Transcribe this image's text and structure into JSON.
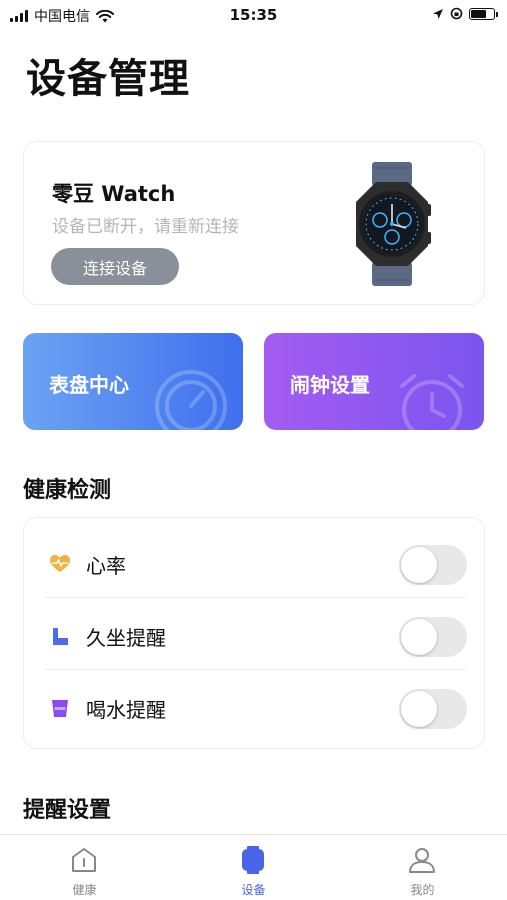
{
  "status_bar": {
    "carrier": "中国电信",
    "time": "15:35"
  },
  "page": {
    "title": "设备管理"
  },
  "device": {
    "name": "零豆 Watch",
    "status": "设备已断开，请重新连接",
    "connect_label": "连接设备"
  },
  "features": {
    "dial_center": "表盘中心",
    "alarm_settings": "闹钟设置"
  },
  "health": {
    "section_title": "健康检测",
    "items": [
      {
        "label": "心率",
        "icon": "heart-rate-icon",
        "enabled": false,
        "color": "#f2b13a"
      },
      {
        "label": "久坐提醒",
        "icon": "sedentary-icon",
        "enabled": false,
        "color": "#4d6ce8"
      },
      {
        "label": "喝水提醒",
        "icon": "water-cup-icon",
        "enabled": false,
        "color": "#8a4cf0"
      }
    ]
  },
  "reminder": {
    "section_title": "提醒设置"
  },
  "tabbar": {
    "items": [
      {
        "label": "健康",
        "icon": "health-tab-icon",
        "active": false
      },
      {
        "label": "设备",
        "icon": "device-tab-icon",
        "active": true
      },
      {
        "label": "我的",
        "icon": "profile-tab-icon",
        "active": false
      }
    ]
  },
  "colors": {
    "accent": "#4a64e6",
    "dial_gradient_start": "#6ba3f2",
    "dial_gradient_end": "#3f6fee",
    "alarm_gradient_start": "#a45cf2",
    "alarm_gradient_end": "#7b55ef"
  }
}
